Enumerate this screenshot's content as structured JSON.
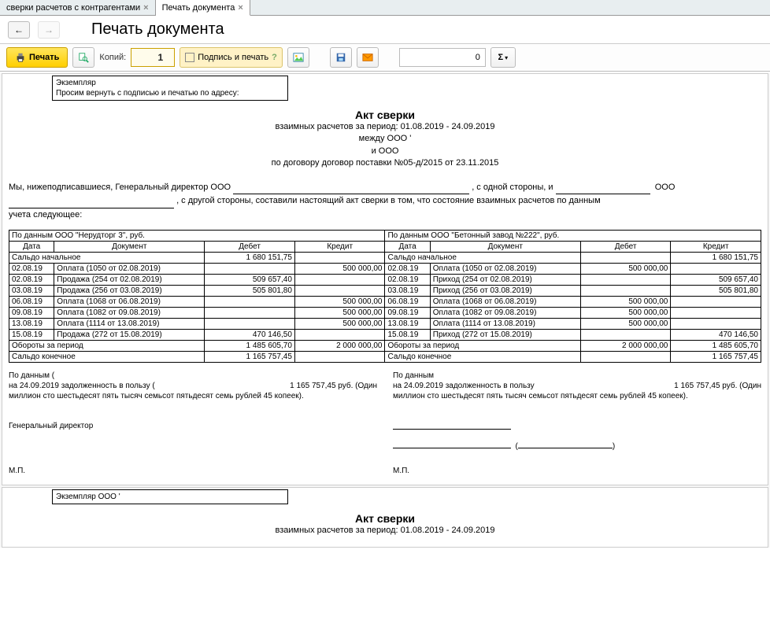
{
  "tabs": {
    "t0": "сверки расчетов с контрагентами",
    "t1": "Печать документа"
  },
  "page_title": "Печать документа",
  "toolbar": {
    "print": "Печать",
    "copies_label": "Копий:",
    "copies_value": "1",
    "sign_print": "Подпись и печать",
    "zero_value": "0",
    "sigma": "Σ"
  },
  "doc": {
    "exem_line1": "Экземпляр",
    "exem_line2": "Просим вернуть с подписью и печатью по адресу:",
    "title": "Акт сверки",
    "sub1": "взаимных расчетов за период: 01.08.2019 - 24.09.2019",
    "sub2": "между ООО '",
    "sub3": "и ООО",
    "sub4": "по договору договор поставки №05-д/2015 от 23.11.2015",
    "intro_a": "Мы, нижеподписавшиеся, Генеральный директор ООО",
    "intro_b": ", с одной стороны, и",
    "intro_c": "ООО",
    "intro_d": ", с другой стороны, составили настоящий акт сверки в том, что состояние взаимных расчетов по данным",
    "intro_e": "учета следующее:",
    "left_header": "По данным ООО \"Нерудторг 3\", руб.",
    "right_header": "По данным ООО \"Бетонный завод №222\", руб.",
    "col_date": "Дата",
    "col_doc": "Документ",
    "col_debit": "Дебет",
    "col_credit": "Кредит",
    "saldo_start": "Сальдо начальное",
    "turnover": "Обороты за период",
    "saldo_end": "Сальдо конечное",
    "left_rows": [
      {
        "date": "",
        "doc": "Сальдо начальное",
        "debit": "1 680 151,75",
        "credit": ""
      },
      {
        "date": "02.08.19",
        "doc": "Оплата (1050 от 02.08.2019)",
        "debit": "",
        "credit": "500 000,00"
      },
      {
        "date": "02.08.19",
        "doc": "Продажа (254 от 02.08.2019)",
        "debit": "509 657,40",
        "credit": ""
      },
      {
        "date": "03.08.19",
        "doc": "Продажа (256 от 03.08.2019)",
        "debit": "505 801,80",
        "credit": ""
      },
      {
        "date": "06.08.19",
        "doc": "Оплата (1068 от 06.08.2019)",
        "debit": "",
        "credit": "500 000,00"
      },
      {
        "date": "09.08.19",
        "doc": "Оплата (1082 от 09.08.2019)",
        "debit": "",
        "credit": "500 000,00"
      },
      {
        "date": "13.08.19",
        "doc": "Оплата (1114 от 13.08.2019)",
        "debit": "",
        "credit": "500 000,00"
      },
      {
        "date": "15.08.19",
        "doc": "Продажа (272 от 15.08.2019)",
        "debit": "470 146,50",
        "credit": ""
      },
      {
        "date": "",
        "doc": "Обороты за период",
        "debit": "1 485 605,70",
        "credit": "2 000 000,00"
      },
      {
        "date": "",
        "doc": "Сальдо конечное",
        "debit": "1 165 757,45",
        "credit": ""
      }
    ],
    "right_rows": [
      {
        "date": "",
        "doc": "Сальдо начальное",
        "debit": "",
        "credit": "1 680 151,75"
      },
      {
        "date": "02.08.19",
        "doc": "Оплата (1050 от 02.08.2019)",
        "debit": "500 000,00",
        "credit": ""
      },
      {
        "date": "02.08.19",
        "doc": "Приход (254 от 02.08.2019)",
        "debit": "",
        "credit": "509 657,40"
      },
      {
        "date": "03.08.19",
        "doc": "Приход (256 от 03.08.2019)",
        "debit": "",
        "credit": "505 801,80"
      },
      {
        "date": "06.08.19",
        "doc": "Оплата (1068 от 06.08.2019)",
        "debit": "500 000,00",
        "credit": ""
      },
      {
        "date": "09.08.19",
        "doc": "Оплата (1082 от 09.08.2019)",
        "debit": "500 000,00",
        "credit": ""
      },
      {
        "date": "13.08.19",
        "doc": "Оплата (1114 от 13.08.2019)",
        "debit": "500 000,00",
        "credit": ""
      },
      {
        "date": "15.08.19",
        "doc": "Приход (272 от 15.08.2019)",
        "debit": "",
        "credit": "470 146,50"
      },
      {
        "date": "",
        "doc": "Обороты за период",
        "debit": "2 000 000,00",
        "credit": "1 485 605,70"
      },
      {
        "date": "",
        "doc": "Сальдо конечное",
        "debit": "",
        "credit": "1 165 757,45"
      }
    ],
    "below_left1": "По данным (",
    "below_left2": "на 24.09.2019 задолженность в пользу (",
    "below_left_amt": "1 165 757,45 руб. (Один",
    "below_left3": "миллион сто шестьдесят пять тысяч семьсот пятьдесят семь рублей 45 копеек).",
    "below_right1": "По данным",
    "below_right2": "на 24.09.2019 задолженность в пользу",
    "below_right_amt": "1 165 757,45 руб. (Один",
    "below_right3": "миллион сто шестьдесят пять тысяч семьсот пятьдесят семь рублей 45 копеек).",
    "gendir": "Генеральный директор",
    "mp": "М.П.",
    "exem2": "Экземпляр ООО '"
  }
}
